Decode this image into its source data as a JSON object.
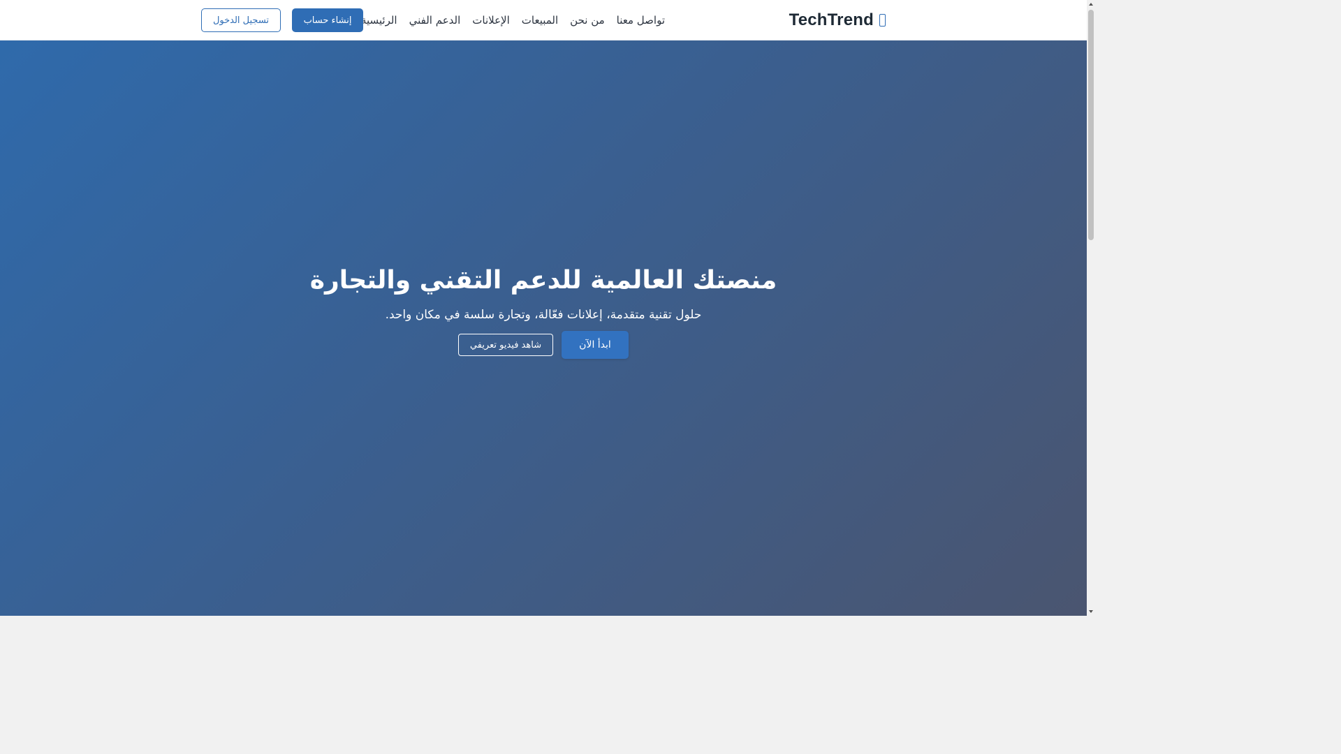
{
  "brand": {
    "name": "TechTrend",
    "icon": "mobile-icon",
    "color": "#2f6db5"
  },
  "nav": {
    "items": [
      {
        "label": "الرئيسية"
      },
      {
        "label": "الدعم الفني"
      },
      {
        "label": "الإعلانات"
      },
      {
        "label": "المبيعات"
      },
      {
        "label": "من نحن"
      },
      {
        "label": "تواصل معنا"
      }
    ],
    "signup_label": "إنشاء حساب",
    "login_label": "تسجيل الدخول"
  },
  "hero": {
    "title": "منصتك العالمية للدعم التقني والتجارة",
    "subtitle": "حلول تقنية متقدمة، إعلانات فعّالة، وتجارة سلسة في مكان واحد.",
    "primary_cta": "ابدأ الآن",
    "secondary_cta": "شاهد فيديو تعريفي",
    "gradient_start": "#2f6aab",
    "gradient_end": "#4a5570"
  },
  "colors": {
    "accent": "#2f6db5",
    "nav_text": "#2c3440"
  }
}
